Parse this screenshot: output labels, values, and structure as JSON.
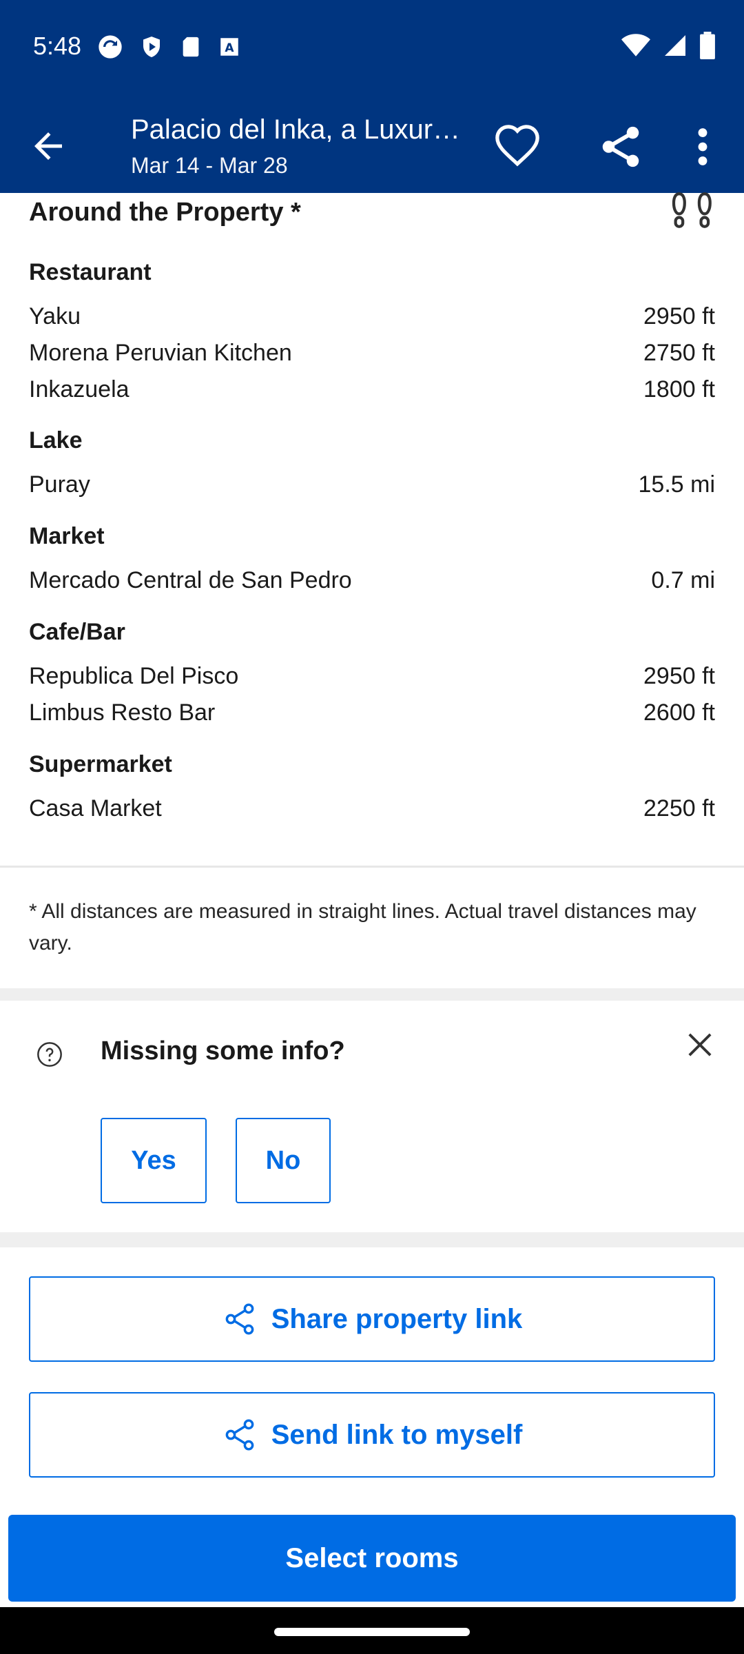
{
  "status_bar": {
    "time": "5:48"
  },
  "app_bar": {
    "title": "Palacio del Inka, a Luxury Collection Hotel, Cusco",
    "dates": "Mar 14 - Mar 28",
    "icons": [
      "back-arrow-icon",
      "heart-icon",
      "share-icon",
      "more-vert-icon"
    ]
  },
  "around": {
    "title": "Around the Property *",
    "categories": [
      {
        "name": "Restaurant",
        "items": [
          {
            "name": "Yaku",
            "distance": "2950 ft"
          },
          {
            "name": "Morena Peruvian Kitchen",
            "distance": "2750 ft"
          },
          {
            "name": "Inkazuela",
            "distance": "1800 ft"
          }
        ]
      },
      {
        "name": "Lake",
        "items": [
          {
            "name": "Puray",
            "distance": "15.5 mi"
          }
        ]
      },
      {
        "name": "Market",
        "items": [
          {
            "name": "Mercado Central de San Pedro",
            "distance": "0.7 mi"
          }
        ]
      },
      {
        "name": "Cafe/Bar",
        "items": [
          {
            "name": "Republica Del Pisco",
            "distance": "2950 ft"
          },
          {
            "name": "Limbus Resto Bar",
            "distance": "2600 ft"
          }
        ]
      },
      {
        "name": "Supermarket",
        "items": [
          {
            "name": "Casa Market",
            "distance": "2250 ft"
          }
        ]
      }
    ],
    "note": "* All distances are measured in straight lines. Actual travel distances may vary."
  },
  "missing_info": {
    "title": "Missing some info?",
    "yes_label": "Yes",
    "no_label": "No"
  },
  "actions": {
    "share_label": "Share property link",
    "send_label": "Send link to myself",
    "select_rooms_label": "Select rooms"
  },
  "colors": {
    "brand_dark": "#003580",
    "accent": "#006ce4"
  }
}
